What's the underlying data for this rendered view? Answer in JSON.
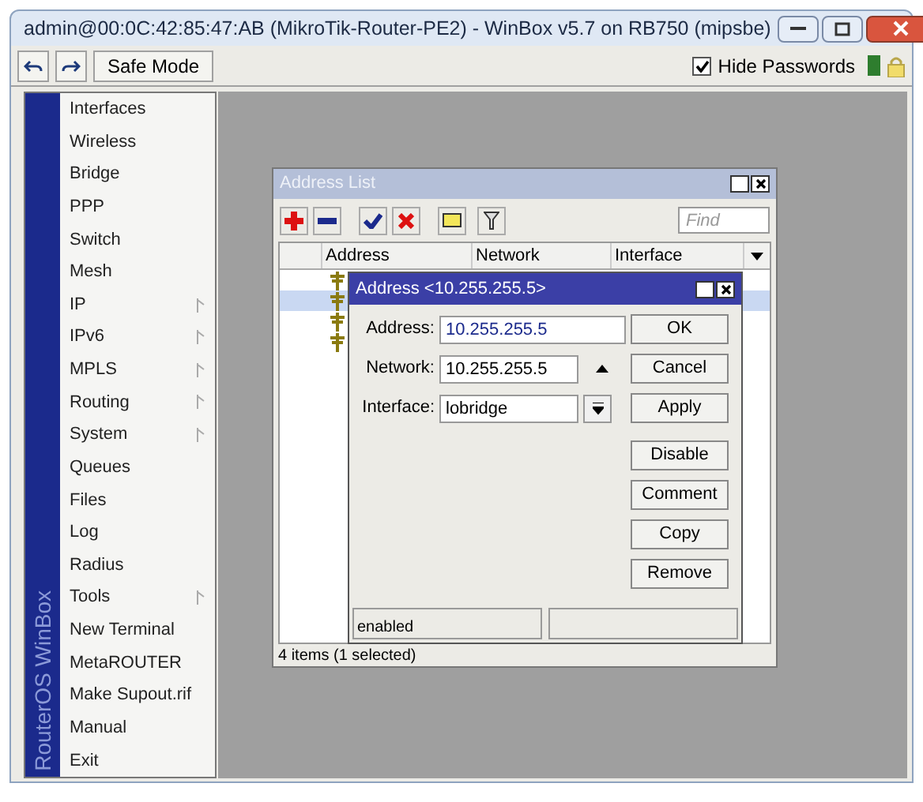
{
  "window": {
    "title": "admin@00:0C:42:85:47:AB (MikroTik-Router-PE2) - WinBox v5.7 on RB750 (mipsbe)"
  },
  "toolbar": {
    "safe_mode": "Safe Mode",
    "hide_passwords": {
      "label": "Hide Passwords",
      "checked": true
    }
  },
  "sidebar": {
    "brand": "RouterOS WinBox",
    "items": [
      {
        "label": "Interfaces",
        "submenu": false
      },
      {
        "label": "Wireless",
        "submenu": false
      },
      {
        "label": "Bridge",
        "submenu": false
      },
      {
        "label": "PPP",
        "submenu": false
      },
      {
        "label": "Switch",
        "submenu": false
      },
      {
        "label": "Mesh",
        "submenu": false
      },
      {
        "label": "IP",
        "submenu": true
      },
      {
        "label": "IPv6",
        "submenu": true
      },
      {
        "label": "MPLS",
        "submenu": true
      },
      {
        "label": "Routing",
        "submenu": true
      },
      {
        "label": "System",
        "submenu": true
      },
      {
        "label": "Queues",
        "submenu": false
      },
      {
        "label": "Files",
        "submenu": false
      },
      {
        "label": "Log",
        "submenu": false
      },
      {
        "label": "Radius",
        "submenu": false
      },
      {
        "label": "Tools",
        "submenu": true
      },
      {
        "label": "New Terminal",
        "submenu": false
      },
      {
        "label": "MetaROUTER",
        "submenu": false
      },
      {
        "label": "Make Supout.rif",
        "submenu": false
      },
      {
        "label": "Manual",
        "submenu": false
      },
      {
        "label": "Exit",
        "submenu": false
      }
    ]
  },
  "address_list": {
    "title": "Address List",
    "find_placeholder": "Find",
    "columns": [
      "Address",
      "Network",
      "Interface"
    ],
    "rows": [
      {
        "selected": false
      },
      {
        "selected": true
      },
      {
        "selected": false
      },
      {
        "selected": false
      }
    ],
    "status": "4 items (1 selected)"
  },
  "dialog": {
    "title": "Address <10.255.255.5>",
    "fields": [
      {
        "label": "Address:",
        "value": "10.255.255.5",
        "kind": "text"
      },
      {
        "label": "Network:",
        "value": "10.255.255.5",
        "kind": "collapse"
      },
      {
        "label": "Interface:",
        "value": "lobridge",
        "kind": "dropdown"
      }
    ],
    "buttons": [
      "OK",
      "Cancel",
      "Apply",
      "Disable",
      "Comment",
      "Copy",
      "Remove"
    ],
    "status": "enabled"
  }
}
